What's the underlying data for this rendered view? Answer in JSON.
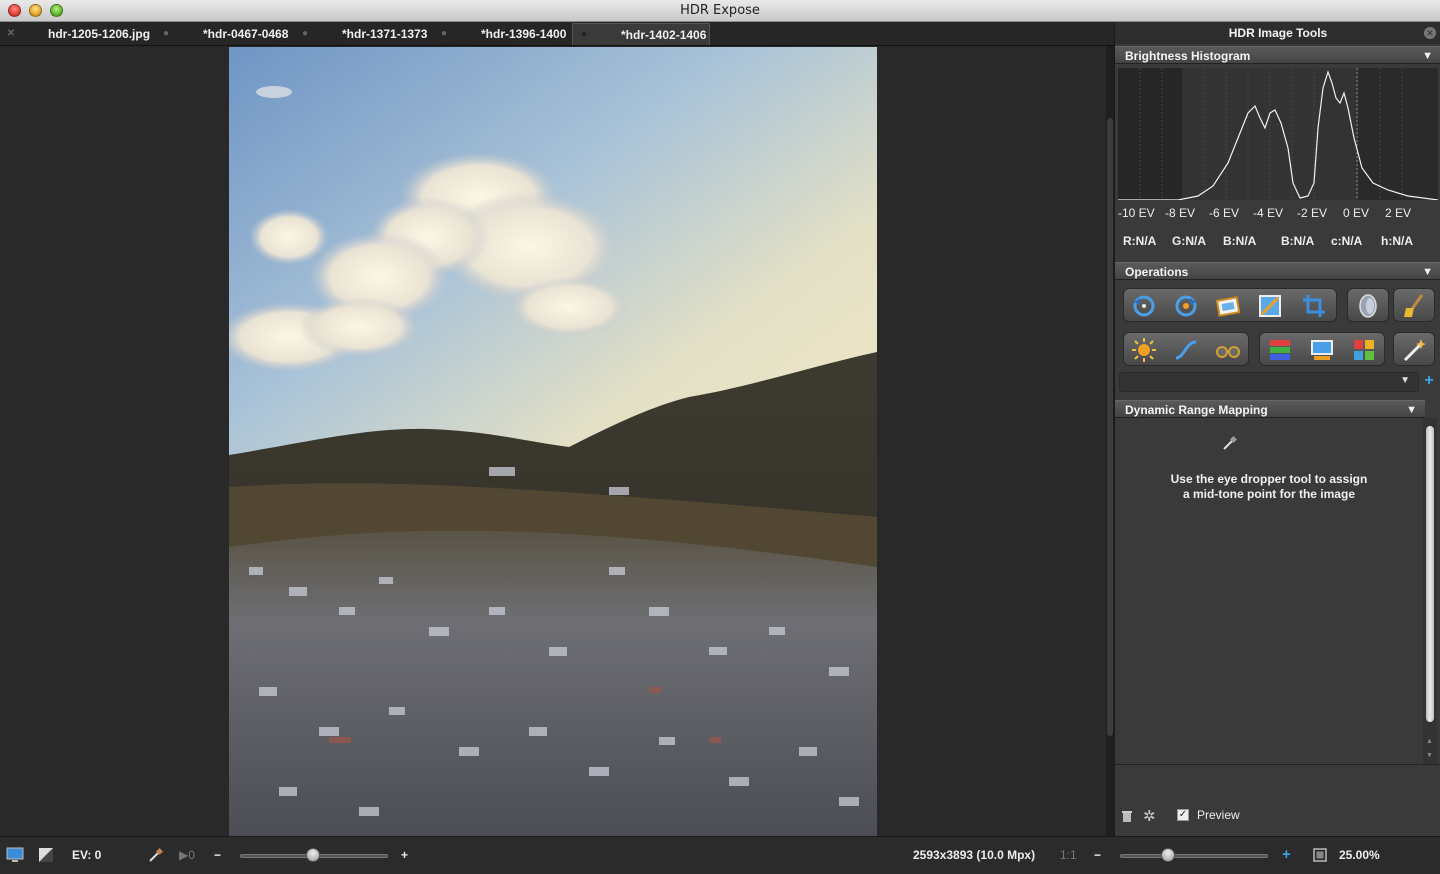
{
  "window": {
    "title": "HDR Expose"
  },
  "tabs": [
    {
      "label": "hdr-1205-1206.jpg"
    },
    {
      "label": "*hdr-0467-0468"
    },
    {
      "label": "*hdr-1371-1373"
    },
    {
      "label": "*hdr-1396-1400"
    },
    {
      "label": "*hdr-1402-1406"
    }
  ],
  "panel": {
    "title": "HDR Image Tools",
    "histogram": {
      "header": "Brightness Histogram",
      "ev_labels": [
        "-10 EV",
        "-8 EV",
        "-6 EV",
        "-4 EV",
        "-2 EV",
        "0 EV",
        "2 EV"
      ],
      "readouts": [
        "R:N/A",
        "G:N/A",
        "B:N/A",
        "B:N/A",
        "c:N/A",
        "h:N/A"
      ]
    },
    "operations": {
      "header": "Operations",
      "icons_row1": [
        "rotate-left-icon",
        "rotate-right-icon",
        "frame-icon",
        "straighten-icon",
        "crop-icon",
        "lens-icon",
        "broom-icon"
      ],
      "icons_row2": [
        "exposure-icon",
        "curve-icon",
        "glasses-icon",
        "channels-icon",
        "monitor-icon",
        "color-grid-icon",
        "magic-wand-icon"
      ],
      "add_label": "+"
    },
    "drm": {
      "header": "Dynamic Range Mapping",
      "instruction_line1": "Use the eye dropper tool to assign",
      "instruction_line2": "a mid-tone point for the image"
    },
    "footer": {
      "preview_label": "Preview",
      "preview_checked": true
    }
  },
  "statusbar": {
    "ev": "EV: 0",
    "arrow_zero": "▶0",
    "dimensions": "2593x3893 (10.0 Mpx)",
    "one_to_one": "1:1",
    "zoom": "25.00%",
    "minus": "−",
    "plus": "+"
  },
  "colors": {
    "accent": "#37a6e6",
    "panel_bg": "#3a3a3a",
    "window_bg": "#292929"
  }
}
